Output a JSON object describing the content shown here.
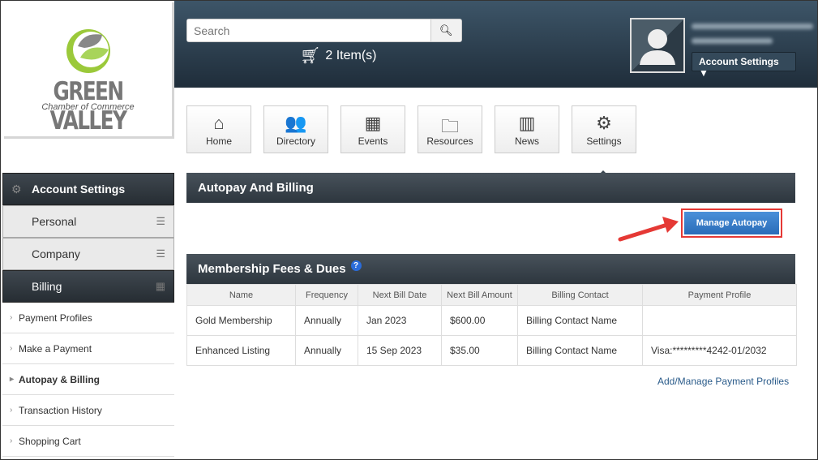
{
  "logo": {
    "title": "GREEN VALLEY",
    "subtitle": "Chamber of Commerce"
  },
  "header": {
    "search_placeholder": "Search",
    "cart": "2 Item(s)",
    "account_button": "Account Settings"
  },
  "nav": [
    {
      "icon": "home-icon",
      "label": "Home",
      "glyph": "⌂"
    },
    {
      "icon": "users-icon",
      "label": "Directory",
      "glyph": "👥"
    },
    {
      "icon": "calendar-icon",
      "label": "Events",
      "glyph": "▦"
    },
    {
      "icon": "folder-icon",
      "label": "Resources",
      "glyph": "🗀"
    },
    {
      "icon": "building-icon",
      "label": "News",
      "glyph": "▥"
    },
    {
      "icon": "gear-icon",
      "label": "Settings",
      "glyph": "⚙"
    }
  ],
  "sidebar": {
    "header": "Account Settings",
    "sections": [
      "Personal",
      "Company",
      "Billing"
    ],
    "items": [
      "Payment Profiles",
      "Make a Payment",
      "Autopay & Billing",
      "Transaction History",
      "Shopping Cart"
    ]
  },
  "main": {
    "title": "Autopay And Billing",
    "manage_button": "Manage Autopay",
    "fees_title": "Membership Fees & Dues",
    "help": "?",
    "add_link": "Add/Manage Payment Profiles",
    "columns": [
      "Name",
      "Frequency",
      "Next Bill Date",
      "Next Bill Amount",
      "Billing Contact",
      "Payment Profile"
    ],
    "rows": [
      [
        "Gold Membership",
        "Annually",
        "Jan 2023",
        "$600.00",
        "Billing Contact Name",
        ""
      ],
      [
        "Enhanced Listing",
        "Annually",
        "15 Sep 2023",
        "$35.00",
        "Billing Contact Name",
        "Visa:*********4242-01/2032"
      ]
    ]
  }
}
